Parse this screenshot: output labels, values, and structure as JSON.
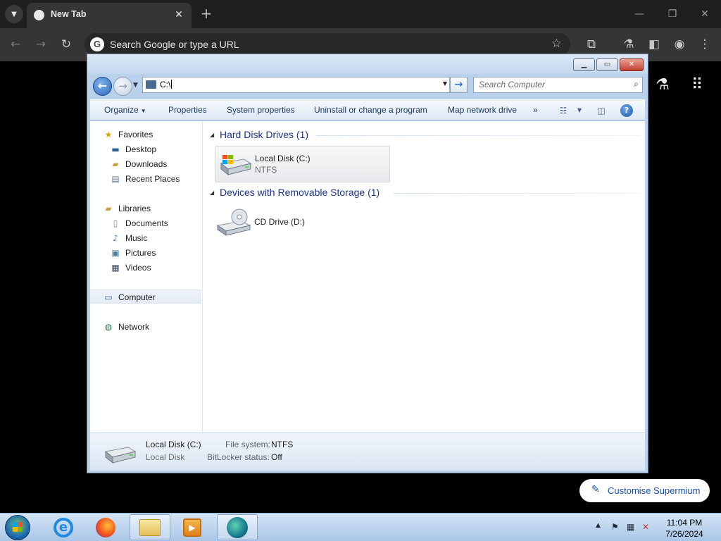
{
  "browser": {
    "tab_title": "New Tab",
    "omnibox_placeholder": "Search Google or type a URL",
    "customise_label": "Customise Supermium"
  },
  "explorer": {
    "address": "C:\\",
    "search_placeholder": "Search Computer",
    "commands": {
      "organize": "Organize",
      "properties": "Properties",
      "system_properties": "System properties",
      "uninstall": "Uninstall or change a program",
      "map_drive": "Map network drive",
      "more": "»"
    },
    "nav": {
      "favorites": "Favorites",
      "desktop": "Desktop",
      "downloads": "Downloads",
      "recent_places": "Recent Places",
      "libraries": "Libraries",
      "documents": "Documents",
      "music": "Music",
      "pictures": "Pictures",
      "videos": "Videos",
      "computer": "Computer",
      "network": "Network"
    },
    "groups": {
      "hdd_label": "Hard Disk Drives (1)",
      "removable_label": "Devices with Removable Storage (1)"
    },
    "drives": {
      "c_name": "Local Disk (C:)",
      "c_fs": "NTFS",
      "d_name": "CD Drive (D:)"
    },
    "details": {
      "name": "Local Disk (C:)",
      "type": "Local Disk",
      "fs_label": "File system:",
      "fs_value": "NTFS",
      "bitlocker_label": "BitLocker status:",
      "bitlocker_value": "Off"
    }
  },
  "taskbar": {
    "time": "11:04 PM",
    "date": "7/26/2024"
  },
  "colors": {
    "explorer_frame": "#b9d1ea",
    "group_header": "#1e3287",
    "chrome_toolbar": "#353535",
    "accent_link": "#1a4fa8"
  }
}
